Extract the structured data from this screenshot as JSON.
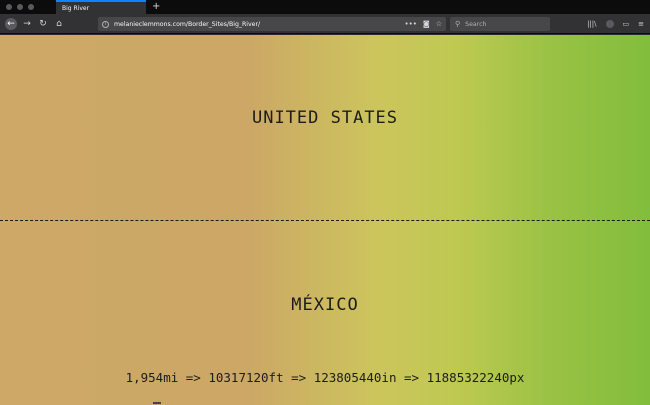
{
  "browser": {
    "tab_title": "Big River",
    "new_tab_glyph": "+",
    "url": "melanieclemmons.com/Border_Sites/Big_River/",
    "search_placeholder": "Search",
    "icons": [
      "back-icon",
      "forward-icon",
      "reload-icon",
      "home-icon",
      "info-icon",
      "more-icon",
      "pocket-icon",
      "bookmark-star-icon",
      "search-icon",
      "library-icon",
      "sync-account-icon",
      "sidebar-icon",
      "menu-icon"
    ]
  },
  "page": {
    "north_label": "UNITED STATES",
    "south_label": "MÉXICO",
    "distance_text": "1,954mi => 10317120ft => 123805440in => 11885322240px"
  },
  "colors": {
    "gradient_left": "#cda866",
    "gradient_mid": "#ccc55c",
    "gradient_right": "#82bd3c",
    "tab_accent": "#0a84ff"
  }
}
